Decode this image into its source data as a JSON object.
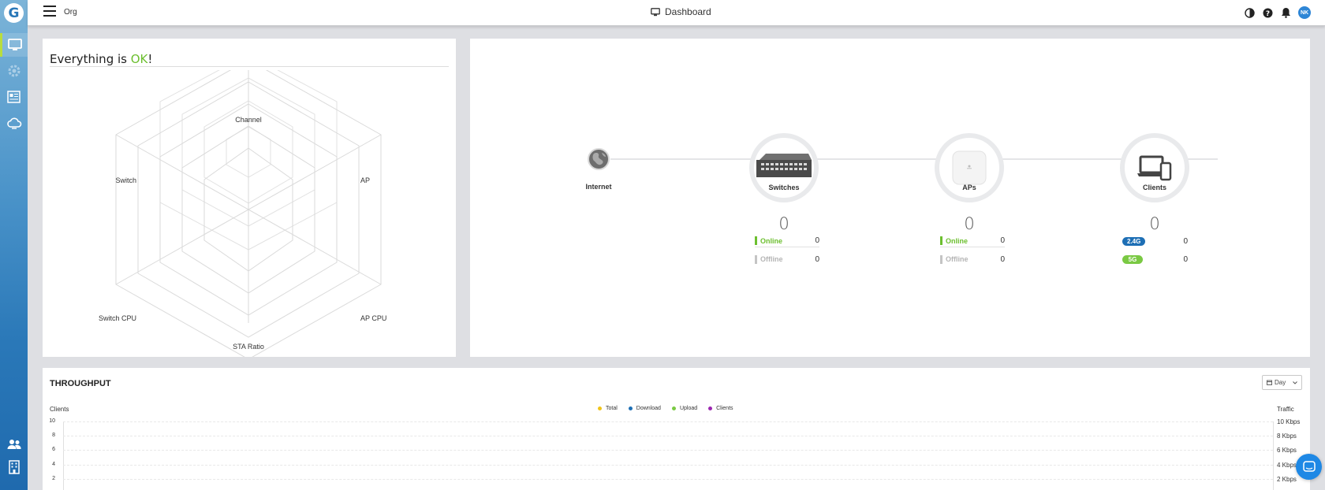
{
  "topbar": {
    "org": "Org",
    "title": "Dashboard",
    "avatar_initials": "NK"
  },
  "sidebar": {
    "logo": "G",
    "items": [
      {
        "icon": "monitor-icon",
        "active": true
      },
      {
        "icon": "gear-icon",
        "active": false
      },
      {
        "icon": "report-icon",
        "active": false
      },
      {
        "icon": "cloud-icon",
        "active": false
      },
      {
        "icon": "users-icon",
        "active": false
      },
      {
        "icon": "building-icon",
        "active": false
      }
    ]
  },
  "status": {
    "title_prefix": "Everything is ",
    "title_ok": "OK",
    "title_suffix": "!",
    "ok_color": "#6cbf2f",
    "radar_axes": [
      "Channel",
      "AP",
      "AP CPU",
      "STA Ratio",
      "Switch CPU",
      "Switch"
    ]
  },
  "topology": {
    "internet": {
      "label": "Internet"
    },
    "switches": {
      "label": "Switches",
      "count": "0",
      "online_label": "Online",
      "online": "0",
      "offline_label": "Offline",
      "offline": "0"
    },
    "aps": {
      "label": "APs",
      "count": "0",
      "online_label": "Online",
      "online": "0",
      "offline_label": "Offline",
      "offline": "0"
    },
    "clients": {
      "label": "Clients",
      "count": "0",
      "band1_label": "2.4G",
      "band1": "0",
      "band2_label": "5G",
      "band2": "0"
    }
  },
  "throughput": {
    "title": "THROUGHPUT",
    "range_button": "Day",
    "left_axis_title": "Clients",
    "right_axis_title": "Traffic",
    "legend": [
      {
        "name": "Total",
        "color": "#f0c419"
      },
      {
        "name": "Download",
        "color": "#1e6fb5"
      },
      {
        "name": "Upload",
        "color": "#7ac943"
      },
      {
        "name": "Clients",
        "color": "#9c27b0"
      }
    ],
    "left_ticks": [
      "10",
      "8",
      "6",
      "4",
      "2"
    ],
    "right_ticks": [
      "10 Kbps",
      "8 Kbps",
      "6 Kbps",
      "4 Kbps",
      "2 Kbps"
    ]
  }
}
